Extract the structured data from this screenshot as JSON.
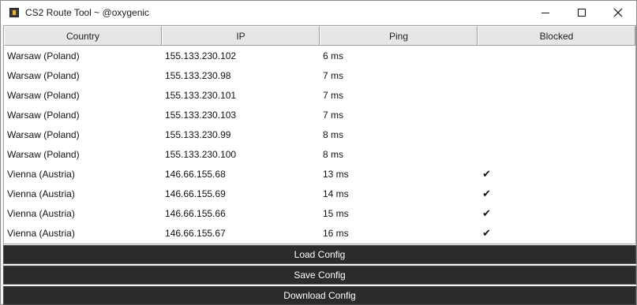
{
  "window": {
    "title": "CS2 Route Tool ~ @oxygenic",
    "icon": "app-icon"
  },
  "table": {
    "headers": [
      "Country",
      "IP",
      "Ping",
      "Blocked"
    ],
    "rows": [
      {
        "country": "Warsaw (Poland)",
        "ip": "155.133.230.102",
        "ping": "6 ms",
        "blocked": ""
      },
      {
        "country": "Warsaw (Poland)",
        "ip": "155.133.230.98",
        "ping": "7 ms",
        "blocked": ""
      },
      {
        "country": "Warsaw (Poland)",
        "ip": "155.133.230.101",
        "ping": "7 ms",
        "blocked": ""
      },
      {
        "country": "Warsaw (Poland)",
        "ip": "155.133.230.103",
        "ping": "7 ms",
        "blocked": ""
      },
      {
        "country": "Warsaw (Poland)",
        "ip": "155.133.230.99",
        "ping": "8 ms",
        "blocked": ""
      },
      {
        "country": "Warsaw (Poland)",
        "ip": "155.133.230.100",
        "ping": "8 ms",
        "blocked": ""
      },
      {
        "country": "Vienna (Austria)",
        "ip": "146.66.155.68",
        "ping": "13 ms",
        "blocked": "✔"
      },
      {
        "country": "Vienna (Austria)",
        "ip": "146.66.155.69",
        "ping": "14 ms",
        "blocked": "✔"
      },
      {
        "country": "Vienna (Austria)",
        "ip": "146.66.155.66",
        "ping": "15 ms",
        "blocked": "✔"
      },
      {
        "country": "Vienna (Austria)",
        "ip": "146.66.155.67",
        "ping": "16 ms",
        "blocked": "✔"
      }
    ]
  },
  "buttons": {
    "load": "Load Config",
    "save": "Save Config",
    "download": "Download Config"
  },
  "colors": {
    "button_bg": "#2b2b2b",
    "header_bg": "#e6e6e6"
  }
}
